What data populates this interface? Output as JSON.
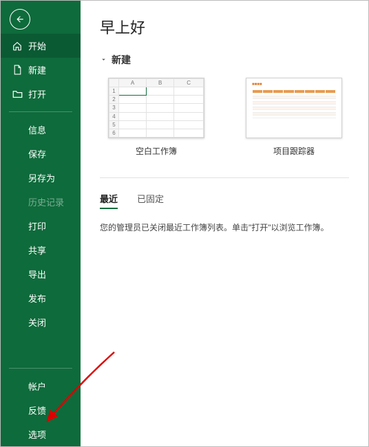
{
  "greeting": "早上好",
  "sidebar": {
    "start": "开始",
    "new": "新建",
    "open": "打开",
    "info": "信息",
    "save": "保存",
    "saveAs": "另存为",
    "history": "历史记录",
    "print": "打印",
    "share": "共享",
    "export": "导出",
    "publish": "发布",
    "close": "关闭",
    "account": "帐户",
    "feedback": "反馈",
    "options": "选项"
  },
  "newSection": {
    "label": "新建",
    "templates": {
      "blank": "空白工作簿",
      "tracker": "项目跟踪器"
    }
  },
  "tabs": {
    "recent": "最近",
    "pinned": "已固定"
  },
  "recentEmpty": "您的管理员已关闭最近工作簿列表。单击\"打开\"以浏览工作簿。"
}
